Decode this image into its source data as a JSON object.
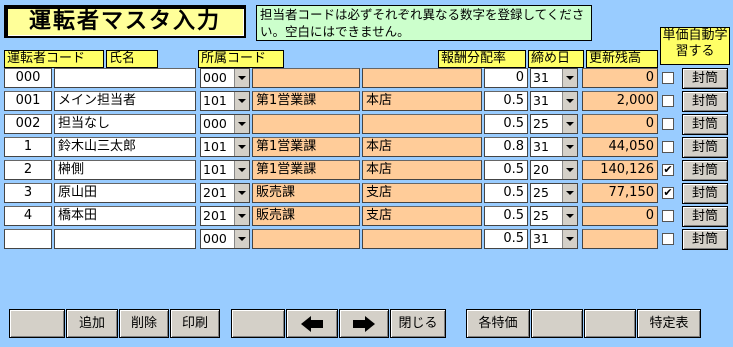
{
  "title": "運転者マスタ入力",
  "notice": "担当者コードは必ずそれぞれ異なる数字を登録してください。空白にはできません。",
  "headers": {
    "code": "運転者コード",
    "name": "氏名",
    "affiliation": "所属コード",
    "rate": "報酬分配率",
    "closing": "締め日",
    "balance": "更新残高",
    "auto": "単価自動学習する"
  },
  "rows": [
    {
      "code": "000",
      "name": "",
      "aff": "000",
      "aff_name": "",
      "branch": "",
      "rate": "0",
      "closing": "31",
      "balance": "0",
      "checked": "",
      "btn": "封筒"
    },
    {
      "code": "001",
      "name": "メイン担当者",
      "aff": "101",
      "aff_name": "第1営業課",
      "branch": "本店",
      "rate": "0.5",
      "closing": "31",
      "balance": "2,000",
      "checked": "",
      "btn": "封筒"
    },
    {
      "code": "002",
      "name": "担当なし",
      "aff": "000",
      "aff_name": "",
      "branch": "",
      "rate": "0.5",
      "closing": "25",
      "balance": "0",
      "checked": "",
      "btn": "封筒"
    },
    {
      "code": "1",
      "name": "鈴木山三太郎",
      "aff": "101",
      "aff_name": "第1営業課",
      "branch": "本店",
      "rate": "0.8",
      "closing": "31",
      "balance": "44,050",
      "checked": "",
      "btn": "封筒"
    },
    {
      "code": "2",
      "name": "榊側",
      "aff": "101",
      "aff_name": "第1営業課",
      "branch": "本店",
      "rate": "0.5",
      "closing": "20",
      "balance": "140,126",
      "checked": "✔",
      "btn": "封筒"
    },
    {
      "code": "3",
      "name": "原山田",
      "aff": "201",
      "aff_name": "販売課",
      "branch": "支店",
      "rate": "0.5",
      "closing": "25",
      "balance": "77,150",
      "checked": "✔",
      "btn": "封筒"
    },
    {
      "code": "4",
      "name": "橋本田",
      "aff": "201",
      "aff_name": "販売課",
      "branch": "支店",
      "rate": "0.5",
      "closing": "25",
      "balance": "0",
      "checked": "",
      "btn": "封筒"
    },
    {
      "code": "",
      "name": "",
      "aff": "000",
      "aff_name": "",
      "branch": "",
      "rate": "0.5",
      "closing": "31",
      "balance": "",
      "checked": "",
      "btn": "封筒"
    }
  ],
  "toolbar": {
    "add": "追加",
    "delete": "削除",
    "print": "印刷",
    "prev_icon": "arrow-left-icon",
    "next_icon": "arrow-right-icon",
    "close": "閉じる",
    "special_price": "各特価",
    "special_table": "特定表"
  }
}
